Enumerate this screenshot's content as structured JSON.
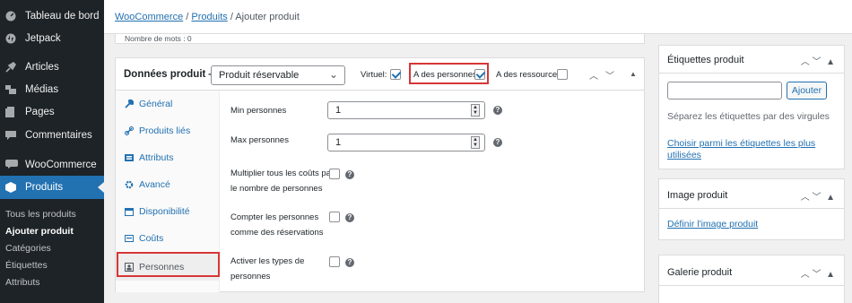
{
  "sidebar": {
    "items": [
      {
        "label": "Tableau de bord",
        "icon": "dashboard-icon"
      },
      {
        "label": "Jetpack",
        "icon": "jetpack-icon"
      },
      {
        "label": "Articles",
        "icon": "pin-icon"
      },
      {
        "label": "Médias",
        "icon": "media-icon"
      },
      {
        "label": "Pages",
        "icon": "pages-icon"
      },
      {
        "label": "Commentaires",
        "icon": "comments-icon"
      },
      {
        "label": "WooCommerce",
        "icon": "woocommerce-icon"
      },
      {
        "label": "Produits",
        "icon": "products-icon"
      }
    ],
    "submenu": [
      "Tous les produits",
      "Ajouter produit",
      "Catégories",
      "Étiquettes",
      "Attributs"
    ]
  },
  "breadcrumb": {
    "link1": "WooCommerce",
    "sep1": "/",
    "link2": "Produits",
    "sep2": "/",
    "current": "Ajouter produit"
  },
  "word_count": "Nombre de mots : 0",
  "product_data": {
    "title": "Données produit —",
    "type_selected": "Produit réservable",
    "virtual_label": "Virtuel:",
    "virtual_checked": true,
    "persons_label": "A des personnes:",
    "persons_checked": true,
    "resources_label": "A des ressources:",
    "resources_checked": false,
    "tabs": [
      {
        "label": "Général",
        "icon": "wrench-icon"
      },
      {
        "label": "Produits liés",
        "icon": "link-icon"
      },
      {
        "label": "Attributs",
        "icon": "attributes-icon"
      },
      {
        "label": "Avancé",
        "icon": "gear-icon"
      },
      {
        "label": "Disponibilité",
        "icon": "calendar-icon"
      },
      {
        "label": "Coûts",
        "icon": "costs-icon"
      },
      {
        "label": "Personnes",
        "icon": "person-icon"
      }
    ],
    "fields": {
      "min_label": "Min personnes",
      "min_value": "1",
      "max_label": "Max personnes",
      "max_value": "1",
      "multiply_label_1": "Multiplier tous les coûts par",
      "multiply_label_2": "le nombre de personnes",
      "count_label_1": "Compter les personnes",
      "count_label_2": "comme des réservations",
      "types_label_1": "Activer les types de",
      "types_label_2": "personnes"
    }
  },
  "tags_box": {
    "title": "Étiquettes produit",
    "add_button": "Ajouter",
    "hint": "Séparez les étiquettes par des virgules",
    "choose_link_1": "Choisir parmi les étiquettes les plus",
    "choose_link_2": "utilisées"
  },
  "image_box": {
    "title": "Image produit",
    "set_link": "Définir l'image produit"
  },
  "gallery_box": {
    "title": "Galerie produit"
  },
  "colors": {
    "accent": "#2271b1",
    "sidebar": "#1d2327",
    "highlight": "#d63638"
  }
}
